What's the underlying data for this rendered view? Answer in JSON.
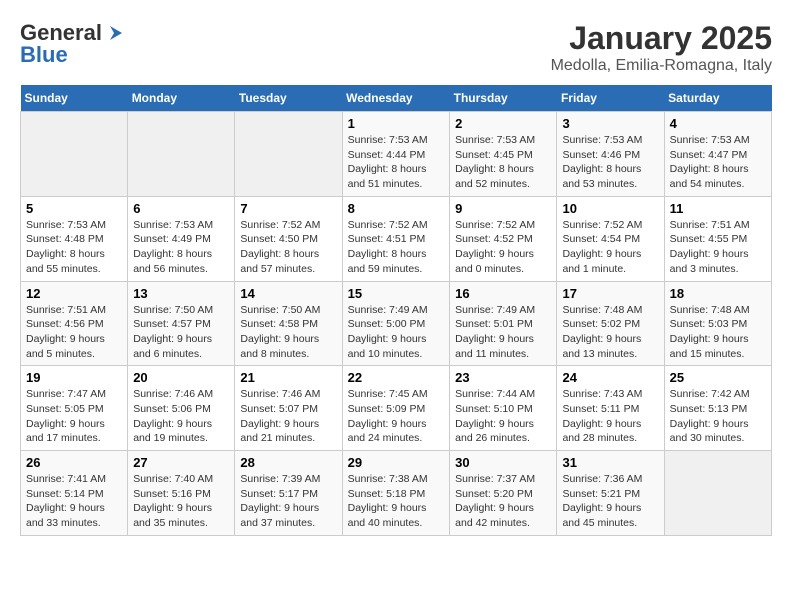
{
  "header": {
    "logo_general": "General",
    "logo_blue": "Blue",
    "month_title": "January 2025",
    "location": "Medolla, Emilia-Romagna, Italy"
  },
  "days_of_week": [
    "Sunday",
    "Monday",
    "Tuesday",
    "Wednesday",
    "Thursday",
    "Friday",
    "Saturday"
  ],
  "weeks": [
    [
      {
        "day": "",
        "info": ""
      },
      {
        "day": "",
        "info": ""
      },
      {
        "day": "",
        "info": ""
      },
      {
        "day": "1",
        "info": "Sunrise: 7:53 AM\nSunset: 4:44 PM\nDaylight: 8 hours and 51 minutes."
      },
      {
        "day": "2",
        "info": "Sunrise: 7:53 AM\nSunset: 4:45 PM\nDaylight: 8 hours and 52 minutes."
      },
      {
        "day": "3",
        "info": "Sunrise: 7:53 AM\nSunset: 4:46 PM\nDaylight: 8 hours and 53 minutes."
      },
      {
        "day": "4",
        "info": "Sunrise: 7:53 AM\nSunset: 4:47 PM\nDaylight: 8 hours and 54 minutes."
      }
    ],
    [
      {
        "day": "5",
        "info": "Sunrise: 7:53 AM\nSunset: 4:48 PM\nDaylight: 8 hours and 55 minutes."
      },
      {
        "day": "6",
        "info": "Sunrise: 7:53 AM\nSunset: 4:49 PM\nDaylight: 8 hours and 56 minutes."
      },
      {
        "day": "7",
        "info": "Sunrise: 7:52 AM\nSunset: 4:50 PM\nDaylight: 8 hours and 57 minutes."
      },
      {
        "day": "8",
        "info": "Sunrise: 7:52 AM\nSunset: 4:51 PM\nDaylight: 8 hours and 59 minutes."
      },
      {
        "day": "9",
        "info": "Sunrise: 7:52 AM\nSunset: 4:52 PM\nDaylight: 9 hours and 0 minutes."
      },
      {
        "day": "10",
        "info": "Sunrise: 7:52 AM\nSunset: 4:54 PM\nDaylight: 9 hours and 1 minute."
      },
      {
        "day": "11",
        "info": "Sunrise: 7:51 AM\nSunset: 4:55 PM\nDaylight: 9 hours and 3 minutes."
      }
    ],
    [
      {
        "day": "12",
        "info": "Sunrise: 7:51 AM\nSunset: 4:56 PM\nDaylight: 9 hours and 5 minutes."
      },
      {
        "day": "13",
        "info": "Sunrise: 7:50 AM\nSunset: 4:57 PM\nDaylight: 9 hours and 6 minutes."
      },
      {
        "day": "14",
        "info": "Sunrise: 7:50 AM\nSunset: 4:58 PM\nDaylight: 9 hours and 8 minutes."
      },
      {
        "day": "15",
        "info": "Sunrise: 7:49 AM\nSunset: 5:00 PM\nDaylight: 9 hours and 10 minutes."
      },
      {
        "day": "16",
        "info": "Sunrise: 7:49 AM\nSunset: 5:01 PM\nDaylight: 9 hours and 11 minutes."
      },
      {
        "day": "17",
        "info": "Sunrise: 7:48 AM\nSunset: 5:02 PM\nDaylight: 9 hours and 13 minutes."
      },
      {
        "day": "18",
        "info": "Sunrise: 7:48 AM\nSunset: 5:03 PM\nDaylight: 9 hours and 15 minutes."
      }
    ],
    [
      {
        "day": "19",
        "info": "Sunrise: 7:47 AM\nSunset: 5:05 PM\nDaylight: 9 hours and 17 minutes."
      },
      {
        "day": "20",
        "info": "Sunrise: 7:46 AM\nSunset: 5:06 PM\nDaylight: 9 hours and 19 minutes."
      },
      {
        "day": "21",
        "info": "Sunrise: 7:46 AM\nSunset: 5:07 PM\nDaylight: 9 hours and 21 minutes."
      },
      {
        "day": "22",
        "info": "Sunrise: 7:45 AM\nSunset: 5:09 PM\nDaylight: 9 hours and 24 minutes."
      },
      {
        "day": "23",
        "info": "Sunrise: 7:44 AM\nSunset: 5:10 PM\nDaylight: 9 hours and 26 minutes."
      },
      {
        "day": "24",
        "info": "Sunrise: 7:43 AM\nSunset: 5:11 PM\nDaylight: 9 hours and 28 minutes."
      },
      {
        "day": "25",
        "info": "Sunrise: 7:42 AM\nSunset: 5:13 PM\nDaylight: 9 hours and 30 minutes."
      }
    ],
    [
      {
        "day": "26",
        "info": "Sunrise: 7:41 AM\nSunset: 5:14 PM\nDaylight: 9 hours and 33 minutes."
      },
      {
        "day": "27",
        "info": "Sunrise: 7:40 AM\nSunset: 5:16 PM\nDaylight: 9 hours and 35 minutes."
      },
      {
        "day": "28",
        "info": "Sunrise: 7:39 AM\nSunset: 5:17 PM\nDaylight: 9 hours and 37 minutes."
      },
      {
        "day": "29",
        "info": "Sunrise: 7:38 AM\nSunset: 5:18 PM\nDaylight: 9 hours and 40 minutes."
      },
      {
        "day": "30",
        "info": "Sunrise: 7:37 AM\nSunset: 5:20 PM\nDaylight: 9 hours and 42 minutes."
      },
      {
        "day": "31",
        "info": "Sunrise: 7:36 AM\nSunset: 5:21 PM\nDaylight: 9 hours and 45 minutes."
      },
      {
        "day": "",
        "info": ""
      }
    ]
  ]
}
